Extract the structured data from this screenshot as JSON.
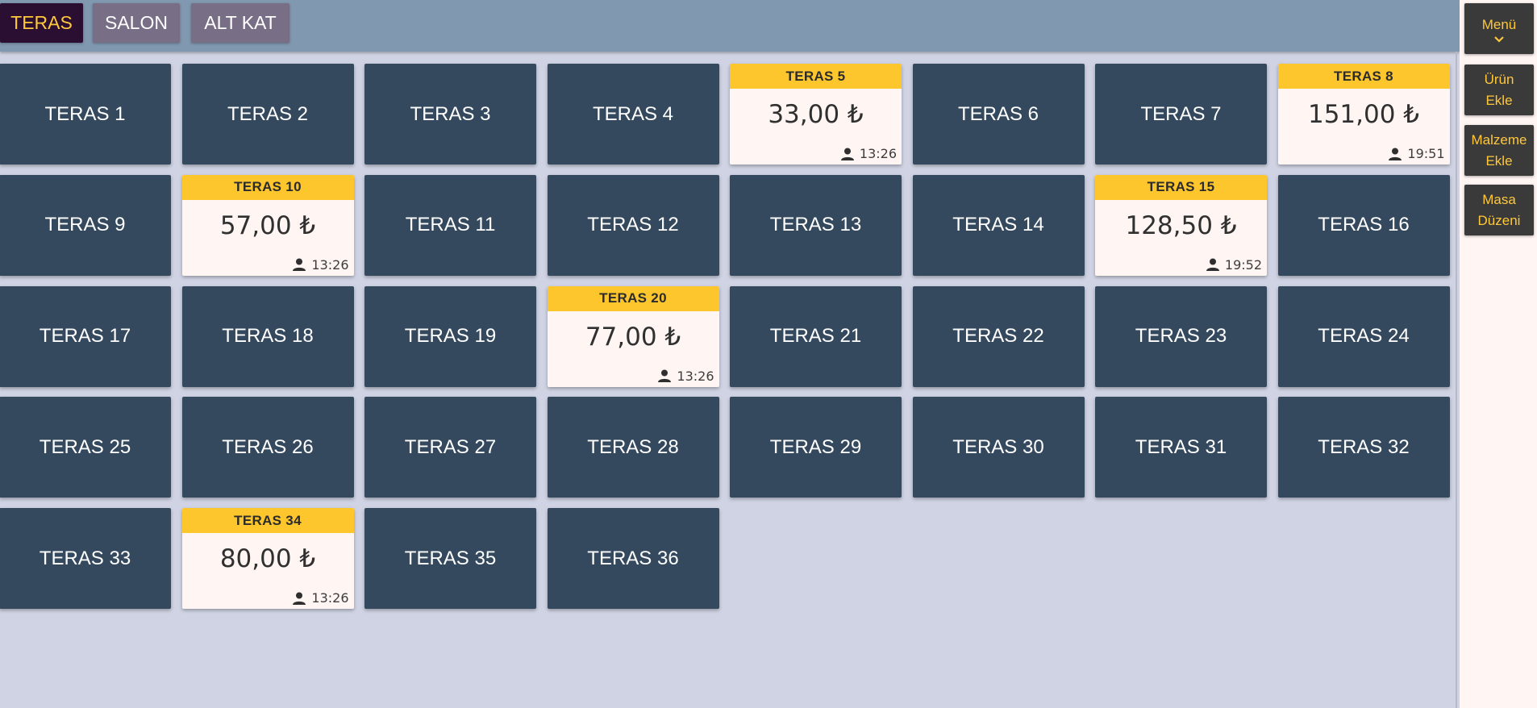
{
  "areas": [
    {
      "label": "TERAS",
      "active": true
    },
    {
      "label": "SALON",
      "active": false
    },
    {
      "label": "ALT KAT",
      "active": false
    }
  ],
  "sidebar": {
    "menu_label": "Menü",
    "add_product": [
      "Ürün",
      "Ekle"
    ],
    "add_material": [
      "Malzeme",
      "Ekle"
    ],
    "table_layout": [
      "Masa",
      "Düzeni"
    ]
  },
  "colors": {
    "free_table": "#34495e",
    "occupied_header": "#fec62d",
    "accent": "#ffc83a",
    "topbar": "#8098b0",
    "background": "#cfd3e3"
  },
  "icons": {
    "waiter": "person-icon",
    "menu": "chevron-down-icon"
  },
  "tables": [
    {
      "name": "TERAS 1"
    },
    {
      "name": "TERAS 2"
    },
    {
      "name": "TERAS 3"
    },
    {
      "name": "TERAS 4"
    },
    {
      "name": "TERAS 5",
      "amount": "33,00 ₺",
      "time": "13:26"
    },
    {
      "name": "TERAS 6"
    },
    {
      "name": "TERAS 7"
    },
    {
      "name": "TERAS 8",
      "amount": "151,00 ₺",
      "time": "19:51"
    },
    {
      "name": "TERAS 9"
    },
    {
      "name": "TERAS 10",
      "amount": "57,00 ₺",
      "time": "13:26"
    },
    {
      "name": "TERAS 11"
    },
    {
      "name": "TERAS 12"
    },
    {
      "name": "TERAS 13"
    },
    {
      "name": "TERAS 14"
    },
    {
      "name": "TERAS 15",
      "amount": "128,50 ₺",
      "time": "19:52"
    },
    {
      "name": "TERAS 16"
    },
    {
      "name": "TERAS 17"
    },
    {
      "name": "TERAS 18"
    },
    {
      "name": "TERAS 19"
    },
    {
      "name": "TERAS 20",
      "amount": "77,00 ₺",
      "time": "13:26"
    },
    {
      "name": "TERAS 21"
    },
    {
      "name": "TERAS 22"
    },
    {
      "name": "TERAS 23"
    },
    {
      "name": "TERAS 24"
    },
    {
      "name": "TERAS 25"
    },
    {
      "name": "TERAS 26"
    },
    {
      "name": "TERAS 27"
    },
    {
      "name": "TERAS 28"
    },
    {
      "name": "TERAS 29"
    },
    {
      "name": "TERAS 30"
    },
    {
      "name": "TERAS 31"
    },
    {
      "name": "TERAS 32"
    },
    {
      "name": "TERAS 33"
    },
    {
      "name": "TERAS 34",
      "amount": "80,00 ₺",
      "time": "13:26"
    },
    {
      "name": "TERAS 35"
    },
    {
      "name": "TERAS 36"
    }
  ]
}
